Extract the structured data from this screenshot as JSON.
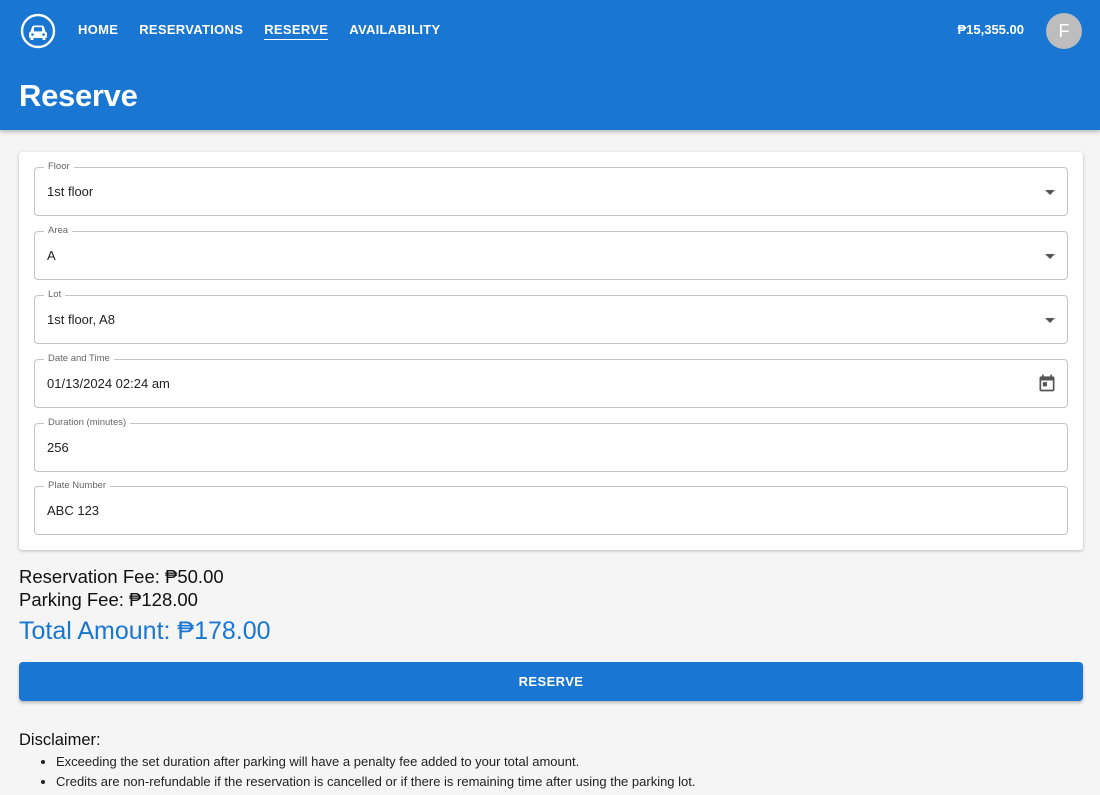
{
  "nav": {
    "items": [
      {
        "label": "HOME"
      },
      {
        "label": "RESERVATIONS"
      },
      {
        "label": "RESERVE"
      },
      {
        "label": "AVAILABILITY"
      }
    ],
    "active": "RESERVE",
    "balance": "₱15,355.00",
    "avatar_initial": "F",
    "logo_icon": "car-logo-icon"
  },
  "page": {
    "title": "Reserve"
  },
  "form": {
    "floor": {
      "label": "Floor",
      "value": "1st floor"
    },
    "area": {
      "label": "Area",
      "value": "A"
    },
    "lot": {
      "label": "Lot",
      "value": "1st floor, A8"
    },
    "datetime": {
      "label": "Date and Time",
      "value": "01/13/2024 02:24 am",
      "icon": "calendar-icon"
    },
    "duration": {
      "label": "Duration (minutes)",
      "value": "256"
    },
    "plate": {
      "label": "Plate Number",
      "value": "ABC 123"
    }
  },
  "summary": {
    "reservation_fee": "Reservation Fee: ₱50.00",
    "parking_fee": "Parking Fee: ₱128.00",
    "total": "Total Amount: ₱178.00"
  },
  "actions": {
    "reserve_label": "RESERVE"
  },
  "disclaimer": {
    "title": "Disclaimer:",
    "items": [
      "Exceeding the set duration after parking will have a penalty fee added to your total amount.",
      "Credits are non-refundable if the reservation is cancelled or if there is remaining time after using the parking lot."
    ]
  },
  "colors": {
    "primary": "#1976d2",
    "background": "#f5f5f5",
    "avatar": "#bdbdbd"
  }
}
